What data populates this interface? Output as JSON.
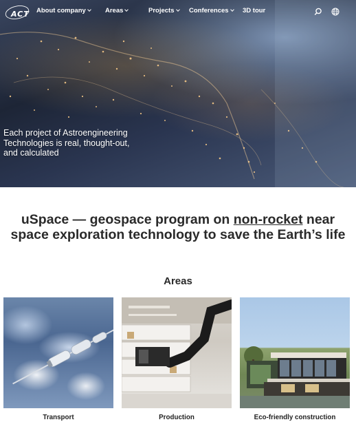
{
  "nav": {
    "logo_text": "ACT",
    "items": [
      {
        "label": "About company",
        "has_dropdown": true
      },
      {
        "label": "Areas",
        "has_dropdown": true
      },
      {
        "label": "Projects",
        "has_dropdown": true
      },
      {
        "label": "Conferences",
        "has_dropdown": true
      },
      {
        "label": "3D tour",
        "has_dropdown": false
      }
    ],
    "icons": [
      "search-icon",
      "globe-icon"
    ]
  },
  "hero": {
    "caption": "Each project of Astroengineering Technologies is real, thought-out, and calculated"
  },
  "headline": {
    "before": "uSpace — geospace program on ",
    "link": "non-rocket",
    "after": " near space exploration technology to save the Earth’s life"
  },
  "areas": {
    "title": "Areas",
    "cards": [
      {
        "label": "Transport"
      },
      {
        "label": "Production"
      },
      {
        "label": "Eco-friendly construction"
      }
    ]
  },
  "colors": {
    "text": "#2a2a2a",
    "nav_text": "#ffffff",
    "background": "#ffffff"
  }
}
